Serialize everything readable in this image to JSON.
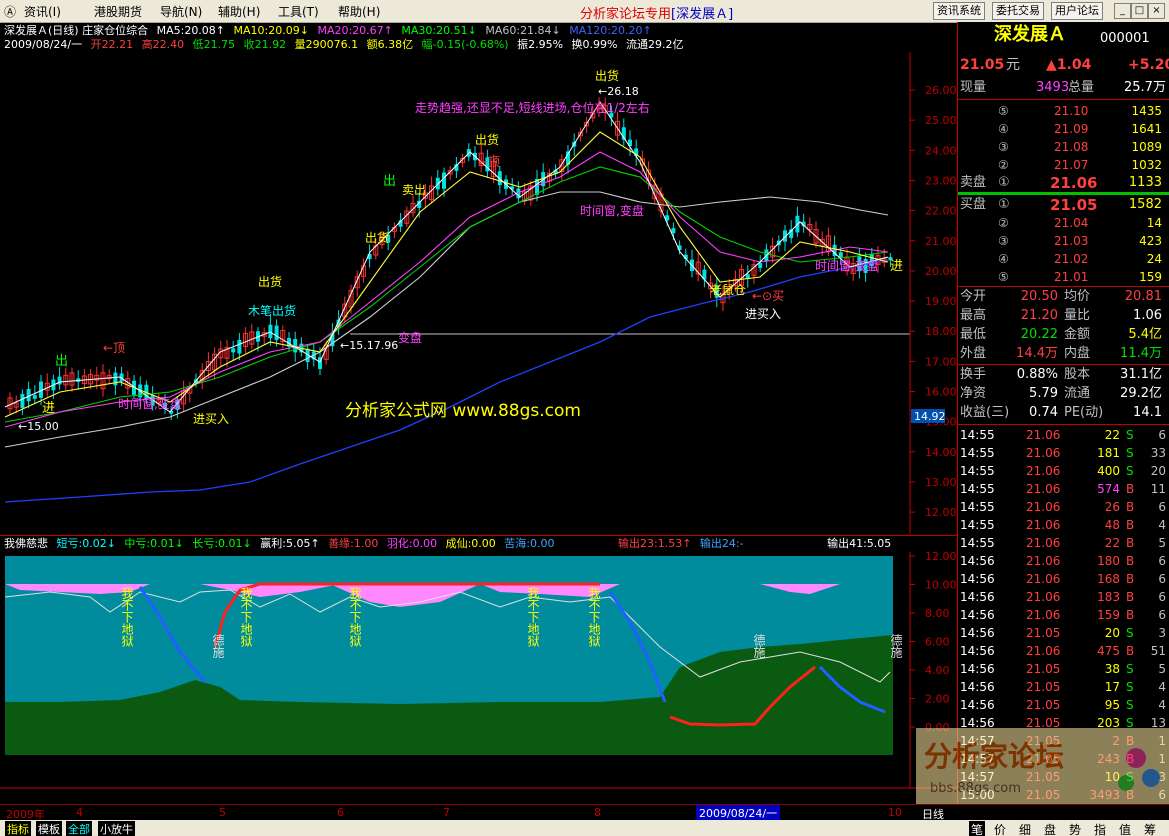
{
  "menubar": {
    "sys": "Ⓐ",
    "items": [
      "资讯(I)",
      "港股期货",
      "导航(N)",
      "辅助(H)",
      "工具(T)",
      "帮助(H)"
    ],
    "title_main": "分析家论坛专用",
    "title_sub": "[深发展Ａ]",
    "buttons": [
      "资讯系统",
      "委托交易",
      "用户论坛"
    ],
    "win_buttons": [
      "_",
      "□",
      "×"
    ]
  },
  "chart": {
    "header1": [
      "深发展Ａ(日线) 庄家仓位综合",
      "MA5:20.08↑",
      "MA10:20.09↓",
      "MA20:20.67↑",
      "MA30:20.51↓",
      "MA60:21.84↓",
      "MA120:20.20↑"
    ],
    "header2": [
      "2009/08/24/一",
      "开22.21",
      "高22.40",
      "低21.75",
      "收21.92",
      "量290076.1",
      "额6.38亿",
      "幅-0.15(-0.68%)",
      "振2.95%",
      "换0.99%",
      "流通29.2亿"
    ],
    "yaxis": [
      "26.00",
      "25.00",
      "24.00",
      "23.00",
      "22.00",
      "21.00",
      "20.00",
      "19.00",
      "18.00",
      "17.00",
      "16.00",
      "15.00",
      "14.00",
      "13.00",
      "12.00"
    ],
    "price_tag": "14.92",
    "watermark": "分析家公式网 www.88gs.com",
    "annotation_top": "走势趋强,还显不足,短线进场,仓位在1/2左右",
    "high_label": "←26.18",
    "low_label": "←15.00",
    "mid_label": "←15.17.96",
    "labels": {
      "chu": "出",
      "jin": "进",
      "ding": "←顶",
      "chuhuo": "出货",
      "mubi": "木笔出货",
      "shijian": "时间窗,变盘",
      "shijian2": "时间窗,变盘",
      "jinmai": "进买入",
      "maichu": "卖出",
      "mai": "←⊙买",
      "laoshu": "老鼠仓",
      "jinmai2": "进买入",
      "biandian": "变盘"
    }
  },
  "indicator": {
    "header": [
      "我佛慈悲",
      "短亏:0.02↓",
      "中亏:0.01↓",
      "长亏:0.01↓",
      "赢利:5.05↑",
      "善缘:1.00",
      "羽化:0.00",
      "成仙:0.00",
      "苦海:0.00",
      "输出23:1.53↑",
      "输出24:-",
      "输出41:5.05"
    ],
    "yaxis": [
      "12.00",
      "10.00",
      "8.00",
      "6.00",
      "4.00",
      "2.00",
      "0.00"
    ],
    "v_texts": [
      "下地狱",
      "我不下地狱",
      "我不下地狱",
      "我不下地狱",
      "我不下地狱"
    ],
    "de_texts": [
      "德施",
      "德施",
      "德施"
    ]
  },
  "xaxis": {
    "labels": [
      "2009年",
      "4",
      "5",
      "6",
      "7",
      "8",
      "10"
    ],
    "date_box": "2009/08/24/一",
    "rightlabel": "日线"
  },
  "tabbar": {
    "items": [
      "指标",
      "模板",
      "全部",
      "小放牛"
    ]
  },
  "panel": {
    "name": "深发展Ａ",
    "code": "000001",
    "price": "21.05",
    "unit": "元",
    "change": "▲1.04",
    "pct": "+5.20",
    "xianliang_label": "现量",
    "xianliang": "3493",
    "zongliang_label": "总量",
    "zongliang": "25.7万",
    "sells": [
      {
        "lvl": "⑤",
        "price": "21.10",
        "vol": "1435"
      },
      {
        "lvl": "④",
        "price": "21.09",
        "vol": "1641"
      },
      {
        "lvl": "③",
        "price": "21.08",
        "vol": "1089"
      },
      {
        "lvl": "②",
        "price": "21.07",
        "vol": "1032"
      }
    ],
    "sell1": {
      "label": "卖盘",
      "lvl": "①",
      "price": "21.06",
      "vol": "1133"
    },
    "buy1": {
      "label": "买盘",
      "lvl": "①",
      "price": "21.05",
      "vol": "1582"
    },
    "buys": [
      {
        "lvl": "②",
        "price": "21.04",
        "vol": "14"
      },
      {
        "lvl": "③",
        "price": "21.03",
        "vol": "423"
      },
      {
        "lvl": "④",
        "price": "21.02",
        "vol": "24"
      },
      {
        "lvl": "⑤",
        "price": "21.01",
        "vol": "159"
      }
    ],
    "stats": [
      {
        "l1": "今开",
        "v1": "20.50",
        "l2": "均价",
        "v2": "20.81"
      },
      {
        "l1": "最高",
        "v1": "21.20",
        "l2": "量比",
        "v2": "1.06"
      },
      {
        "l1": "最低",
        "v1": "20.22",
        "l2": "金额",
        "v2": "5.4亿"
      },
      {
        "l1": "外盘",
        "v1": "14.4万",
        "l2": "内盘",
        "v2": "11.4万"
      }
    ],
    "stats2": [
      {
        "l1": "换手",
        "v1": "0.88%",
        "l2": "股本",
        "v2": "31.1亿"
      },
      {
        "l1": "净资",
        "v1": "5.79",
        "l2": "流通",
        "v2": "29.2亿"
      },
      {
        "l1": "收益(三)",
        "v1": "0.74",
        "l2": "PE(动)",
        "v2": "14.1"
      }
    ],
    "ticks": [
      {
        "t": "14:55",
        "p": "21.06",
        "v": "22",
        "s": "S",
        "n": "6"
      },
      {
        "t": "14:55",
        "p": "21.06",
        "v": "181",
        "s": "S",
        "n": "33"
      },
      {
        "t": "14:55",
        "p": "21.06",
        "v": "400",
        "s": "S",
        "n": "20"
      },
      {
        "t": "14:55",
        "p": "21.06",
        "v": "574",
        "s": "B",
        "n": "11"
      },
      {
        "t": "14:55",
        "p": "21.06",
        "v": "26",
        "s": "B",
        "n": "6"
      },
      {
        "t": "14:55",
        "p": "21.06",
        "v": "48",
        "s": "B",
        "n": "4"
      },
      {
        "t": "14:55",
        "p": "21.06",
        "v": "22",
        "s": "B",
        "n": "5"
      },
      {
        "t": "14:56",
        "p": "21.06",
        "v": "180",
        "s": "B",
        "n": "6"
      },
      {
        "t": "14:56",
        "p": "21.06",
        "v": "168",
        "s": "B",
        "n": "6"
      },
      {
        "t": "14:56",
        "p": "21.06",
        "v": "183",
        "s": "B",
        "n": "6"
      },
      {
        "t": "14:56",
        "p": "21.06",
        "v": "159",
        "s": "B",
        "n": "6"
      },
      {
        "t": "14:56",
        "p": "21.05",
        "v": "20",
        "s": "S",
        "n": "3"
      },
      {
        "t": "14:56",
        "p": "21.06",
        "v": "475",
        "s": "B",
        "n": "51"
      },
      {
        "t": "14:56",
        "p": "21.05",
        "v": "38",
        "s": "S",
        "n": "5"
      },
      {
        "t": "14:56",
        "p": "21.05",
        "v": "17",
        "s": "S",
        "n": "4"
      },
      {
        "t": "14:56",
        "p": "21.05",
        "v": "95",
        "s": "S",
        "n": "4"
      },
      {
        "t": "14:56",
        "p": "21.05",
        "v": "203",
        "s": "S",
        "n": "13"
      },
      {
        "t": "14:57",
        "p": "21.05",
        "v": "2",
        "s": "B",
        "n": "1"
      },
      {
        "t": "14:57",
        "p": "21.05",
        "v": "243",
        "s": "B",
        "n": "1"
      },
      {
        "t": "14:57",
        "p": "21.05",
        "v": "10",
        "s": "S",
        "n": "3"
      },
      {
        "t": "15:00",
        "p": "21.05",
        "v": "3493",
        "s": "B",
        "n": "6"
      }
    ],
    "tabs": [
      "笔",
      "价",
      "细",
      "盘",
      "势",
      "指",
      "值",
      "筹"
    ]
  },
  "forum_watermark": "分析家论坛",
  "forum_url": "bbs.88gs.com"
}
